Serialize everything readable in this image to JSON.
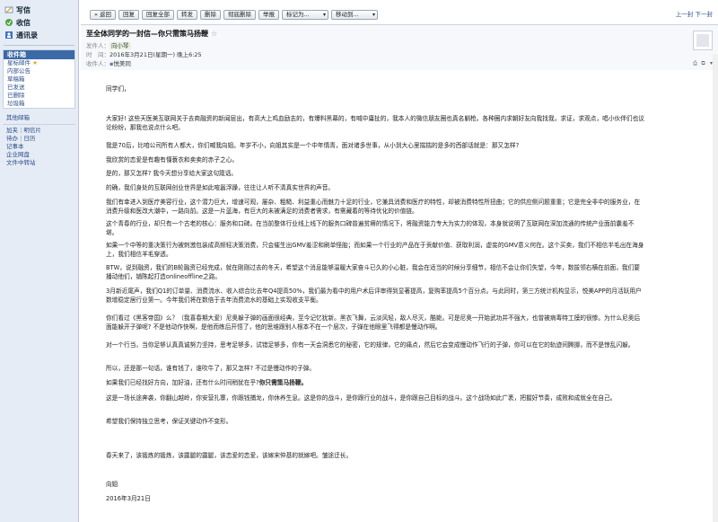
{
  "sidebar": {
    "top": [
      {
        "label": "写信",
        "icon": "pencil-icon"
      },
      {
        "label": "收信",
        "icon": "inbox-icon"
      },
      {
        "label": "通讯录",
        "icon": "contacts-icon"
      }
    ],
    "folder_header": "收件箱",
    "folders": [
      "星标邮件",
      "内部公告",
      "草稿箱",
      "已发送",
      "已删除",
      "垃圾箱"
    ],
    "other_header": "其他邮箱",
    "apps_row1": [
      "加夹",
      "|",
      "明信片"
    ],
    "apps_row2": [
      "待办",
      "|",
      "日历"
    ],
    "apps": [
      "记事本",
      "企业网盘",
      "文件中转站"
    ]
  },
  "toolbar": {
    "buttons": [
      "« 返回",
      "回复",
      "回复全部",
      "转发",
      "删除",
      "彻底删除",
      "举报"
    ],
    "mark_as": "标记为...",
    "move_to": "移动到...",
    "pager": "上一封 下一封"
  },
  "header": {
    "subject": "至全体同学的一封信—你只需策马扬鞭",
    "star": "☆",
    "from_label": "发件人：",
    "from_name": "向小琴",
    "time_label": "时　间：",
    "time": "2016年3月21日(星期一) 晚上6:25",
    "to_label": "收件人：",
    "to_name": "悦美同"
  },
  "body": {
    "greeting": "同学们，",
    "paragraphs": [
      "大家好! 这些天医美互联网关于去商融资的新闻层出，有高大上鸡血励志的，有爆料黑幕的，有喊中庸扯的，我本人的微信朋友圈也真名躺枪。各种圈内求朝好友向我找我，求证，求观点，唱小伙伴们也议论纷纷，那我也说点什么吧。",
      "我是70后，比咱公司所有人都大，你们喊我向姐。年岁不小，向姐其实是一个中年情青，面对诸多世事，从小到大心里揣揣的是多的西部话就是：那又怎样?",
      "我欣赏的恋爱是有趣有懂蓑衣和卖卖的赤子之心。",
      "是的，那又怎样? 我今天想分享给大家这句箴话。",
      "的确，我们身处的互联网创业世界是如此喧嚣浮躁，往往让人听不清真实世界的声音。",
      "我们有幸进入到医疗美容行业，这个潜力巨大，增速可观，屡杂、粗糙、利益重心而魅力十足的行业，它兼具消费和医疗的特性，却被消费特性所扭曲；它的供应侧问题重重；它是完全非中的服务业，在消费升级和医改大潮中，一路向前。这是一片蓝海，有巨大的未被满足的消费者需求，有需藏着的等待优化的价值链。",
      "这个青春的行业，却只有一个古老的核心：服务和口碑。在当前整体行业线上线下的服务口碑普遍贫瘠的情况下，将融资能力专大为实力的体现，本身就说明了互联网在深加流通的传统产业面前囊羞不堪。",
      "如果一个中等的重决策行为被刺激包装成高频轻决策消费，只会催生出GMV羞涩和刷单怪胎；而如果一个行业的产品在于贡献价值、获取利润，虚妄的GMV意义何在。这个买卖，我们不相信半毛出在海身上，我们相信羊毛穿透。",
      "BTW，说到融资，我们的B轮融资已经完成，就在刚刚过去的冬天，希望这个消息能够温暖大家奋斗已久的小心脏，我会在适当的时候分享细节，相信不会让你们失望，今年，数拔领右横在前面，我们要播动他们，铺陈起打造onlineoffline之路。",
      "3月新近尾声，我们Q1的订单量、消费流水、收入综合比去年Q4提高50%，我们最为看中的用户术后评审得到显著提高，复购率提高5个百分点。与此同时，第三方统计机构显示，悦美APP的月活跃用户数增稳定居行业第一。今年我们将在数倍于去年消费流水的基础上实现收支平衡。",
      "你们看过《黑客帝国》么？（我喜春期大爱）尼奥躲子弹的画面很经典，至今记忆犹新。黑衣飞舞，云淡风轻，敌人尽灭，酷毙。可是尼奥一开始武功并不强大，也曾被病毒特工摸的很惨。为什么尼奥后面能躲开子弹呢? 不是他动作快啊，是他而练后开悟了，他的思维跟别人根本不在一个层次，子弹在他眼里飞得都是慢动作啊。",
      "对一个行当，当你足够认真真诚努力坚持，思考足够多，试错足够多，你有一天会洞悉它的秘密，它的规律，它的痛点，然后它会变成慢动作飞行的子弹，你可以在它的轨迹间腾挪，而不是惊乱闪躲。",
      "所以，还是那一句话，谁有钱了，谁吹牛了，那又怎样? 不过是慢动作的子弹。",
      "这是一场长途奔袭，你翻山越岭，你安营扎寨，你跟钱捕龙，你休养生息。这是你的战斗，是你跟行业的战斗，是你跟自己目标的战斗。这个战场如此广袤，把握好节奏，成败和成就全在自己。",
      "希望我们保持独立思考，保证关键动作不变形。",
      "春天来了，该锻炼的锻炼，该露腿的露腿，该恋爱的恋爱，该嫁宋仲基的就嫁吧。皱途迂长。",
      "向姐",
      "2016年3月21日"
    ],
    "horse_line_prefix": "如果我们已经找好方向，加好油，还有什么时间稍犹在乎?",
    "horse_line_bold": "你只需策马扬鞭。"
  }
}
